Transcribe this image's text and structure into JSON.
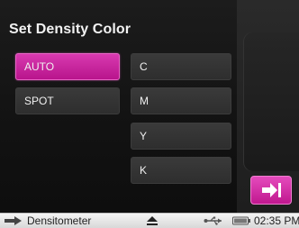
{
  "panel": {
    "title": "Set Density Color"
  },
  "mode_buttons": {
    "auto": "AUTO",
    "spot": "SPOT",
    "selected": "AUTO"
  },
  "color_buttons": {
    "c": "C",
    "m": "M",
    "y": "Y",
    "k": "K"
  },
  "navigation": {
    "next_icon": "arrow-right-to-bar-icon"
  },
  "status_bar": {
    "app_icon": "arrow-right-icon",
    "app_name": "Densitometer",
    "eject_icon": "eject-icon",
    "usb_icon": "usb-icon",
    "battery_icon": "battery-icon",
    "time": "02:35 PM"
  },
  "colors": {
    "accent": "#c8209c",
    "background": "#121212",
    "button": "#333333",
    "status_bar": "#e6e6e6"
  }
}
